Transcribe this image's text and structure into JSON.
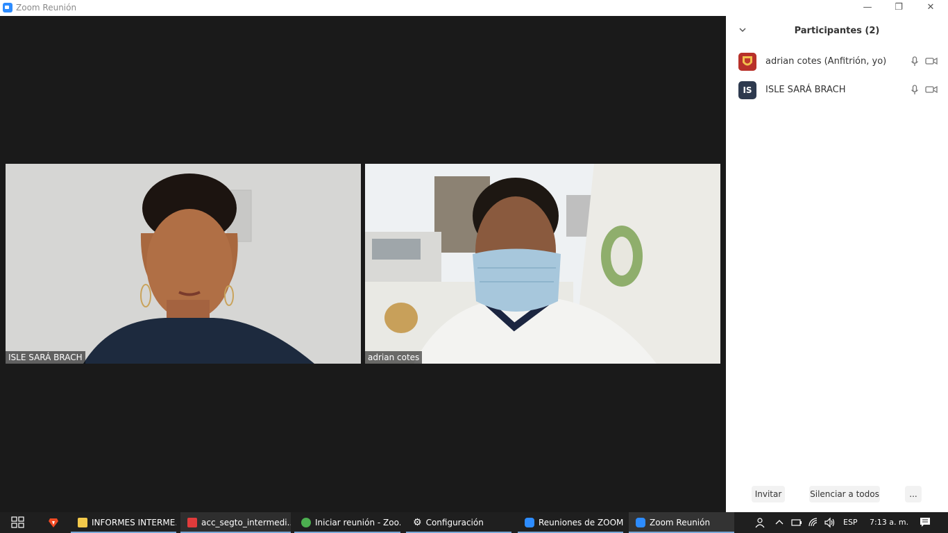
{
  "window": {
    "title": "Zoom Reunión",
    "controls": {
      "minimize": "—",
      "restore": "❐",
      "close": "✕"
    }
  },
  "videos": [
    {
      "name": "ISLE SARÁ BRACH"
    },
    {
      "name": "adrian cotes"
    }
  ],
  "participants_panel": {
    "title": "Participantes (2)",
    "participants": [
      {
        "name": "adrian cotes (Anfitrión, yo)",
        "avatar_text": "",
        "avatar_color": "#c0392b"
      },
      {
        "name": "ISLE SARÁ BRACH",
        "avatar_text": "IS",
        "avatar_color": "#2e3a4f"
      }
    ],
    "buttons": {
      "invite": "Invitar",
      "mute_all": "Silenciar a todos",
      "more": "..."
    }
  },
  "taskbar": {
    "items": [
      {
        "label": "INFORMES INTERME...",
        "icon": "folder-icon",
        "color": "#f3c94b"
      },
      {
        "label": "acc_segto_intermedi...",
        "icon": "pdf-icon",
        "color": "#e03b3b"
      },
      {
        "label": "Iniciar reunión - Zoo...",
        "icon": "chrome-icon",
        "color": "#4caf50"
      },
      {
        "label": "Configuración",
        "icon": "gear-icon",
        "color": "#ffffff"
      },
      {
        "label": "Reuniones de ZOOM...",
        "icon": "zoom-icon",
        "color": "#2d8cff"
      },
      {
        "label": "Zoom Reunión",
        "icon": "zoom-icon",
        "color": "#2d8cff"
      }
    ],
    "tray": {
      "language": "ESP",
      "time": "7:13 a. m."
    }
  },
  "colors": {
    "accent": "#2d8cff",
    "stage": "#1a1a1a",
    "panel": "#ffffff",
    "taskbar": "#1f1f1f"
  }
}
